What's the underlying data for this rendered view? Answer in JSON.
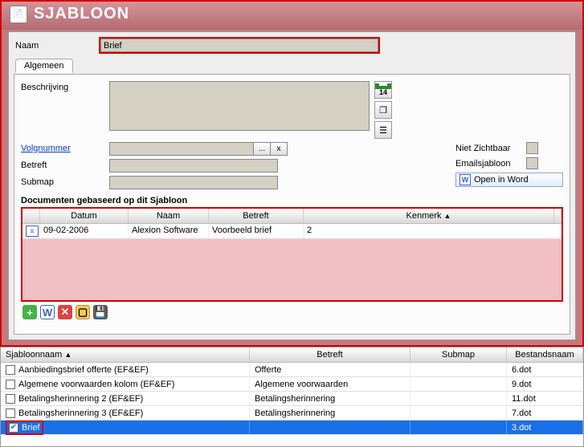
{
  "window": {
    "title": "SJABLOON"
  },
  "form": {
    "name_label": "Naam",
    "name_value": "Brief",
    "tab_general": "Algemeen",
    "desc_label": "Beschrijving",
    "desc_value": "",
    "volg_label": "Volgnummer",
    "volg_value": "",
    "volg_btn": "...",
    "volg_x": "x",
    "betreft_label": "Betreft",
    "betreft_value": "",
    "submap_label": "Submap",
    "submap_value": "",
    "nietzichtbaar_label": "Niet Zichtbaar",
    "emailsjabloon_label": "Emailsjabloon",
    "openword_label": "Open in Word",
    "calendar_number": "14",
    "documents_section": "Documenten gebaseerd op dit Sjabloon",
    "mg_head": {
      "datum": "Datum",
      "naam": "Naam",
      "betreft": "Betreft",
      "kenmerk": "Kenmerk"
    },
    "mg_rows": [
      {
        "datum": "09-02-2006",
        "naam": "Alexion Software",
        "betreft": "Voorbeeld brief",
        "kenmerk": "2"
      }
    ]
  },
  "biggrid": {
    "head": {
      "sjabloonnaam": "Sjabloonnaam",
      "betreft": "Betreft",
      "submap": "Submap",
      "bestandsnaam": "Bestandsnaam"
    },
    "rows": [
      {
        "checked": false,
        "sjabloonnaam": "Aanbiedingsbrief offerte (EF&EF)",
        "betreft": "Offerte",
        "submap": "",
        "bestandsnaam": "6.dot",
        "selected": false
      },
      {
        "checked": false,
        "sjabloonnaam": "Algemene voorwaarden kolom (EF&EF)",
        "betreft": "Algemene voorwaarden",
        "submap": "",
        "bestandsnaam": "9.dot",
        "selected": false
      },
      {
        "checked": false,
        "sjabloonnaam": "Betalingsherinnering 2 (EF&EF)",
        "betreft": "Betalingsherinnering",
        "submap": "",
        "bestandsnaam": "11.dot",
        "selected": false
      },
      {
        "checked": false,
        "sjabloonnaam": "Betalingsherinnering 3 (EF&EF)",
        "betreft": "Betalingsherinnering",
        "submap": "",
        "bestandsnaam": "7.dot",
        "selected": false
      },
      {
        "checked": true,
        "sjabloonnaam": "Brief",
        "betreft": "",
        "submap": "",
        "bestandsnaam": "3.dot",
        "selected": true
      }
    ]
  }
}
